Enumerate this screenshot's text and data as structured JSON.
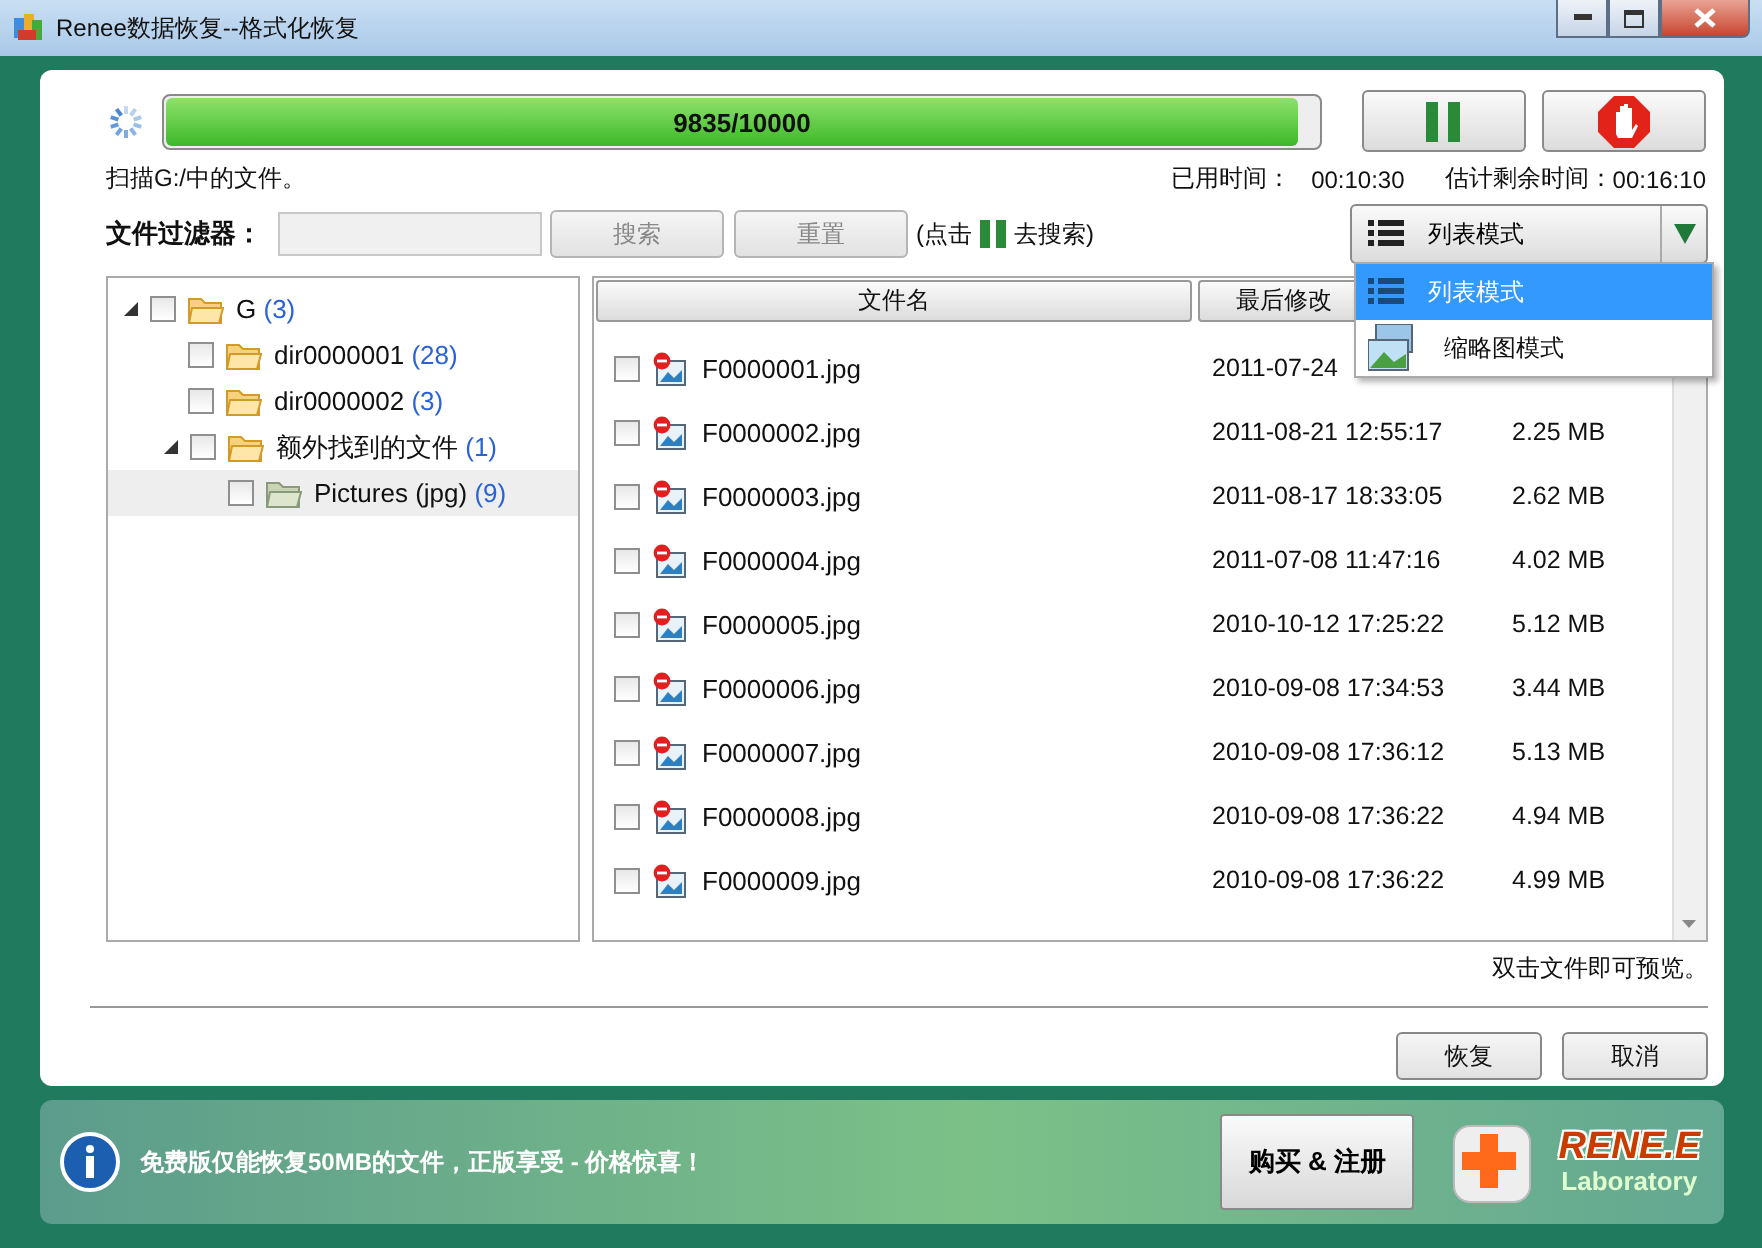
{
  "window": {
    "title": "Renee数据恢复--格式化恢复"
  },
  "progress": {
    "text": "9835/10000",
    "level": 0.9835
  },
  "status": {
    "scanning": "扫描G:/中的文件。",
    "elapsed_label": "已用时间：",
    "elapsed": "00:10:30",
    "remaining_label": "估计剩余时间：",
    "remaining": "00:16:10"
  },
  "filter": {
    "label": "文件过滤器：",
    "search_button": "搜索",
    "reset_button": "重置",
    "hint_before": "(点击",
    "hint_after": "去搜索)"
  },
  "view_mode": {
    "current": "列表模式",
    "expanded": true,
    "options": [
      {
        "label": "列表模式",
        "kind": "list",
        "selected": true
      },
      {
        "label": "缩略图模式",
        "kind": "thumbnail",
        "selected": false
      }
    ]
  },
  "tree": [
    {
      "name": "G",
      "count": "(3)",
      "checked": false,
      "expanded": true,
      "selected": false,
      "children": [
        {
          "name": "dir0000001",
          "count": "(28)",
          "checked": false,
          "selected": false
        },
        {
          "name": "dir0000002",
          "count": "(3)",
          "checked": false,
          "selected": false
        },
        {
          "name": "额外找到的文件",
          "count": "(1)",
          "checked": false,
          "expanded": true,
          "selected": false,
          "children": [
            {
              "name": "Pictures (jpg)",
              "count": "(9)",
              "checked": false,
              "selected": true
            }
          ]
        }
      ]
    }
  ],
  "table": {
    "columns": [
      "文件名",
      "最后修改"
    ],
    "rows": [
      {
        "name": "F0000001.jpg",
        "date": "2011-07-24",
        "checked": false
      },
      {
        "name": "F0000002.jpg",
        "date": "2011-08-21 12:55:17",
        "size": "2.25 MB",
        "checked": false
      },
      {
        "name": "F0000003.jpg",
        "date": "2011-08-17 18:33:05",
        "size": "2.62 MB",
        "checked": false
      },
      {
        "name": "F0000004.jpg",
        "date": "2011-07-08 11:47:16",
        "size": "4.02 MB",
        "checked": false
      },
      {
        "name": "F0000005.jpg",
        "date": "2010-10-12 17:25:22",
        "size": "5.12 MB",
        "checked": false
      },
      {
        "name": "F0000006.jpg",
        "date": "2010-09-08 17:34:53",
        "size": "3.44 MB",
        "checked": false
      },
      {
        "name": "F0000007.jpg",
        "date": "2010-09-08 17:36:12",
        "size": "5.13 MB",
        "checked": false
      },
      {
        "name": "F0000008.jpg",
        "date": "2010-09-08 17:36:22",
        "size": "4.94 MB",
        "checked": false
      },
      {
        "name": "F0000009.jpg",
        "date": "2010-09-08 17:36:22",
        "size": "4.99 MB",
        "checked": false
      }
    ]
  },
  "preview_hint": "双击文件即可预览。",
  "buttons": {
    "recover": "恢复",
    "cancel": "取消"
  },
  "footer": {
    "notice": "免费版仅能恢复50MB的文件，正版享受 - 价格惊喜！",
    "buy_button": "购买 & 注册",
    "logo_name": "RENE.E",
    "logo_sub": "Laboratory"
  }
}
